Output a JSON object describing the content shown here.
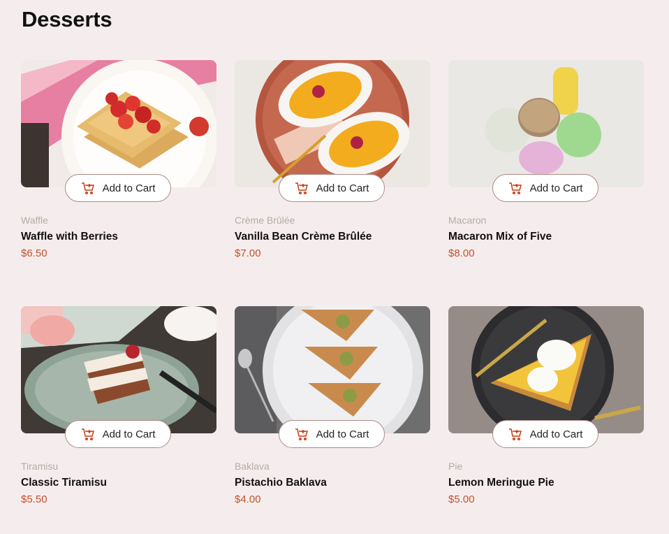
{
  "page": {
    "title": "Desserts"
  },
  "cart_button_label": "Add to Cart",
  "icons": {
    "cart": "add-to-cart-icon"
  },
  "colors": {
    "background": "#f5eded",
    "price": "#c4512c",
    "accent_icon": "#c73b0f",
    "category": "#b7aaa7"
  },
  "products": [
    {
      "category": "Waffle",
      "name": "Waffle with Berries",
      "price": "$6.50"
    },
    {
      "category": "Crème Brûlée",
      "name": "Vanilla Bean Crème Brûlée",
      "price": "$7.00"
    },
    {
      "category": "Macaron",
      "name": "Macaron Mix of Five",
      "price": "$8.00"
    },
    {
      "category": "Tiramisu",
      "name": "Classic Tiramisu",
      "price": "$5.50"
    },
    {
      "category": "Baklava",
      "name": "Pistachio Baklava",
      "price": "$4.00"
    },
    {
      "category": "Pie",
      "name": "Lemon Meringue Pie",
      "price": "$5.00"
    }
  ]
}
